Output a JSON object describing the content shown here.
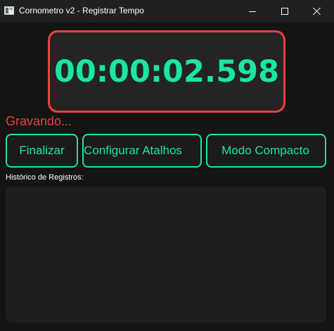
{
  "window": {
    "title": "Cornometro v2 - Registrar Tempo"
  },
  "timer": {
    "display": "00:00:02.598"
  },
  "status": {
    "text": "Gravando..."
  },
  "buttons": {
    "finish_label": "Finalizar",
    "config_label": "Configurar Atalhos",
    "compact_label": "Modo Compacto"
  },
  "history": {
    "label": "Histórico de Registros:",
    "entries": []
  },
  "colors": {
    "accent": "#19e6a1",
    "recording": "#ef3e3e",
    "background": "#141414",
    "panel": "#1e1e1e"
  },
  "icons": {
    "app": "app-window-icon",
    "minimize": "minimize-icon",
    "maximize": "maximize-icon",
    "close": "close-icon"
  }
}
